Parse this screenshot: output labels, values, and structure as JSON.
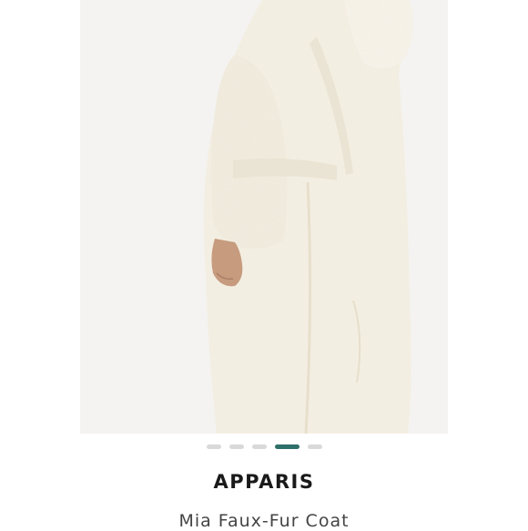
{
  "product": {
    "brand": "APPARIS",
    "name": "Mia Faux-Fur Coat",
    "image_icon": "faux-fur-coat-photo"
  },
  "carousel": {
    "total_slides": 5,
    "active_index": 3
  },
  "colors": {
    "image_background": "#f4f3f1",
    "coat_cream": "#f6f1e4",
    "dot_inactive": "#d9d9d9",
    "dot_active": "#2f6f6a"
  }
}
